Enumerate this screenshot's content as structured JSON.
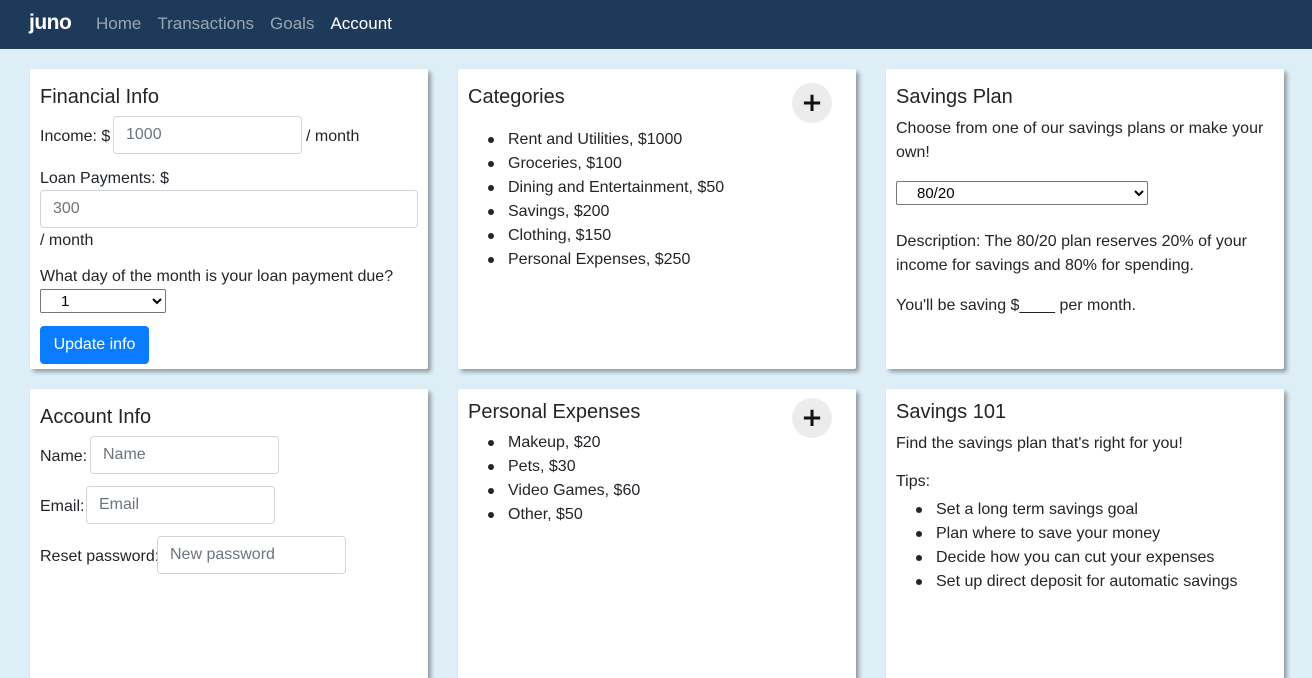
{
  "nav": {
    "brand": "juno",
    "links": [
      "Home",
      "Transactions",
      "Goals",
      "Account"
    ],
    "active": "Account"
  },
  "financial": {
    "title": "Financial Info",
    "income_label": "Income: $",
    "income_placeholder": "1000",
    "per_month": "/ month",
    "loan_label": "Loan Payments: $",
    "loan_placeholder": "300",
    "loan_per_month": "/ month",
    "due_label": "What day of the month is your loan payment due?",
    "due_value": "1",
    "update_button": "Update info"
  },
  "categories": {
    "title": "Categories",
    "add_icon": "+",
    "items": [
      "Rent and Utilities, $1000",
      "Groceries, $100",
      "Dining and Entertainment, $50",
      "Savings, $200",
      "Clothing, $150",
      "Personal Expenses, $250"
    ]
  },
  "savings_plan": {
    "title": "Savings Plan",
    "intro": "Choose from one of our savings plans or make your own!",
    "selected_plan": "80/20",
    "description": "Description: The 80/20 plan reserves 20% of your income for savings and 80% for spending.",
    "saving_text": "You'll be saving $____ per month."
  },
  "account": {
    "title": "Account Info",
    "name_label": "Name:",
    "name_placeholder": "Name",
    "email_label": "Email:",
    "email_placeholder": "Email",
    "password_label": "Reset password:",
    "password_placeholder": "New password"
  },
  "personal_expenses": {
    "title": "Personal Expenses",
    "add_icon": "+",
    "items": [
      "Makeup, $20",
      "Pets, $30",
      "Video Games, $60",
      "Other, $50"
    ]
  },
  "savings101": {
    "title": "Savings 101",
    "intro": "Find the savings plan that's right for you!",
    "tips_label": "Tips:",
    "tips": [
      "Set a long term savings goal",
      "Plan where to save your money",
      "Decide how you can cut your expenses",
      "Set up direct deposit for automatic savings"
    ]
  },
  "colors": {
    "navbar": "#1e3a5a",
    "background": "#ddeef6",
    "primary_button": "#0a7cff"
  }
}
